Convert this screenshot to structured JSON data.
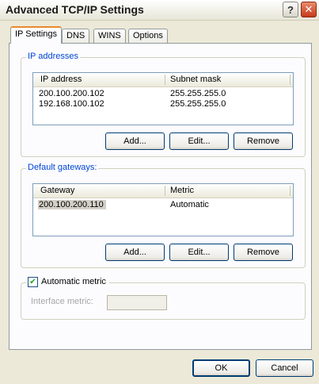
{
  "window": {
    "title": "Advanced TCP/IP Settings",
    "help_glyph": "?",
    "close_glyph": "✕"
  },
  "tabs": [
    {
      "label": "IP Settings",
      "active": true
    },
    {
      "label": "DNS",
      "active": false
    },
    {
      "label": "WINS",
      "active": false
    },
    {
      "label": "Options",
      "active": false
    }
  ],
  "ip_addresses": {
    "group_label": "IP addresses",
    "columns": [
      "IP address",
      "Subnet mask"
    ],
    "rows": [
      [
        "200.100.200.102",
        "255.255.255.0"
      ],
      [
        "192.168.100.102",
        "255.255.255.0"
      ]
    ],
    "add_label": "Add...",
    "edit_label": "Edit...",
    "remove_label": "Remove"
  },
  "default_gateways": {
    "group_label": "Default gateways:",
    "columns": [
      "Gateway",
      "Metric"
    ],
    "rows": [
      [
        "200.100.200.110",
        "Automatic"
      ]
    ],
    "add_label": "Add...",
    "edit_label": "Edit...",
    "remove_label": "Remove"
  },
  "metric": {
    "checkbox_label": "Automatic metric",
    "checked": true,
    "check_glyph": "✔",
    "interface_metric_label": "Interface metric:",
    "interface_metric_value": ""
  },
  "footer": {
    "ok_label": "OK",
    "cancel_label": "Cancel"
  }
}
